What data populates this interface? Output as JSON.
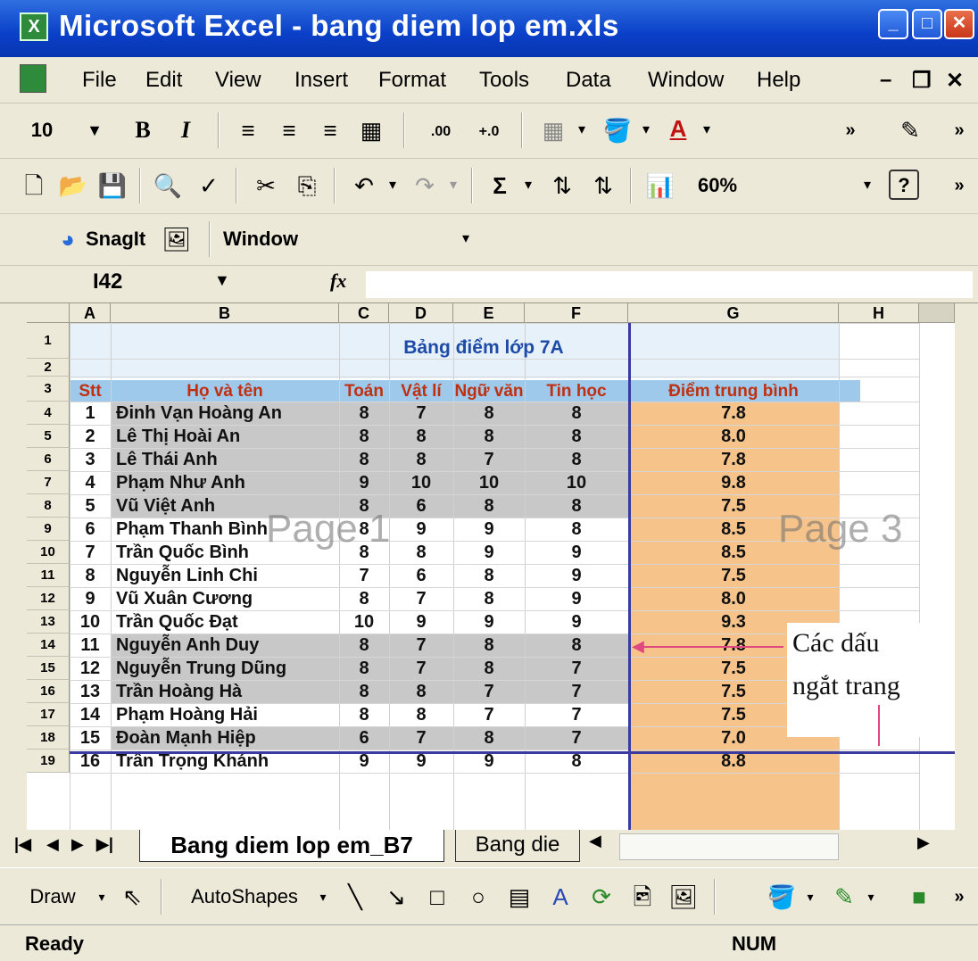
{
  "window": {
    "title": "Microsoft Excel - bang diem lop em.xls"
  },
  "menu": [
    "File",
    "Edit",
    "View",
    "Insert",
    "Format",
    "Tools",
    "Data",
    "Window",
    "Help"
  ],
  "format_toolbar": {
    "font_size": "10",
    "bold": "B",
    "italic": "I",
    "inc_dec": ".00",
    "dec_dec": "+.0"
  },
  "standard_toolbar": {
    "sum": "Σ",
    "zoom": "60%",
    "help": "?"
  },
  "snagit_toolbar": {
    "snagit": "SnagIt",
    "window": "Window"
  },
  "formula": {
    "name_box": "I42",
    "fx": "fx"
  },
  "columns": [
    "A",
    "B",
    "C",
    "D",
    "E",
    "F",
    "G",
    "H"
  ],
  "sheet": {
    "title": "Bảng điểm lớp 7A",
    "headers": [
      "Stt",
      "Họ và tên",
      "Toán",
      "Vật lí",
      "Ngữ văn",
      "Tin học",
      "Điểm trung bình"
    ],
    "rows": [
      [
        "1",
        "Đinh Vạn Hoàng An",
        "8",
        "7",
        "8",
        "8",
        "7.8"
      ],
      [
        "2",
        "Lê Thị Hoài An",
        "8",
        "8",
        "8",
        "8",
        "8.0"
      ],
      [
        "3",
        "Lê Thái Anh",
        "8",
        "8",
        "7",
        "8",
        "7.8"
      ],
      [
        "4",
        "Phạm Như Anh",
        "9",
        "10",
        "10",
        "10",
        "9.8"
      ],
      [
        "5",
        "Vũ Việt Anh",
        "8",
        "6",
        "8",
        "8",
        "7.5"
      ],
      [
        "6",
        "Phạm Thanh Bình",
        "8",
        "9",
        "9",
        "8",
        "8.5"
      ],
      [
        "7",
        "Trần Quốc Bình",
        "8",
        "8",
        "9",
        "9",
        "8.5"
      ],
      [
        "8",
        "Nguyễn Linh Chi",
        "7",
        "6",
        "8",
        "9",
        "7.5"
      ],
      [
        "9",
        "Vũ Xuân Cương",
        "8",
        "7",
        "8",
        "9",
        "8.0"
      ],
      [
        "10",
        "Trần Quốc Đạt",
        "10",
        "9",
        "9",
        "9",
        "9.3"
      ],
      [
        "11",
        "Nguyễn Anh Duy",
        "8",
        "7",
        "8",
        "8",
        "7.8"
      ],
      [
        "12",
        "Nguyễn Trung Dũng",
        "8",
        "7",
        "8",
        "7",
        "7.5"
      ],
      [
        "13",
        "Trần Hoàng Hà",
        "8",
        "8",
        "7",
        "7",
        "7.5"
      ],
      [
        "14",
        "Phạm Hoàng Hải",
        "8",
        "8",
        "7",
        "7",
        "7.5"
      ],
      [
        "15",
        "Đoàn Mạnh Hiệp",
        "6",
        "7",
        "8",
        "7",
        "7.0"
      ],
      [
        "16",
        "Trần Trọng Khánh",
        "9",
        "9",
        "9",
        "8",
        "8.8"
      ]
    ],
    "row_numbers": [
      "1",
      "2",
      "3",
      "4",
      "5",
      "6",
      "7",
      "8",
      "9",
      "10",
      "11",
      "12",
      "13",
      "14",
      "15",
      "16",
      "17",
      "18",
      "19"
    ],
    "page_labels": [
      "Page 1",
      "Page 3"
    ],
    "annotation": [
      "Các dấu",
      "ngắt trang"
    ]
  },
  "tabs": {
    "active": "Bang diem lop em_B7",
    "other": "Bang die"
  },
  "draw_toolbar": {
    "draw": "Draw",
    "autoshapes": "AutoShapes"
  },
  "status": {
    "left": "Ready",
    "right": "NUM"
  },
  "colors": {
    "header_blue": "#9ec9ea",
    "orange": "#f6c48a",
    "gray_band": "#c8c8c8",
    "break_line": "#3a3aa0",
    "red_text": "#c03010"
  }
}
